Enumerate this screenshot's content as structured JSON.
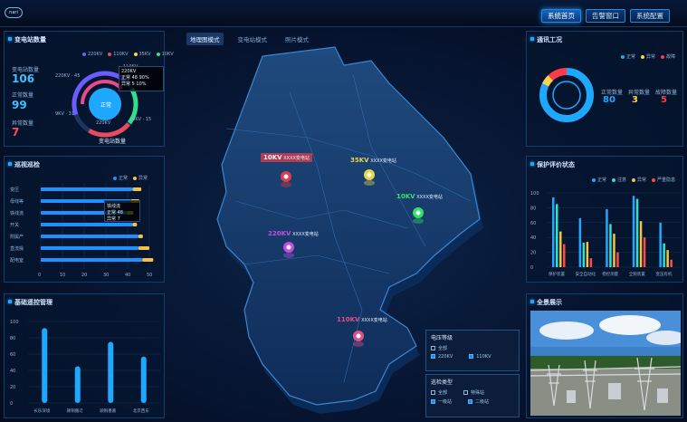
{
  "header": {
    "logo": "nari",
    "buttons": [
      "系统首页",
      "告警窗口",
      "系统配置"
    ],
    "active": 0
  },
  "panel1": {
    "title": "变电站数量",
    "legend": [
      {
        "label": "220KV",
        "color": "#6a5cff"
      },
      {
        "label": "110KV",
        "color": "#e84a5f"
      },
      {
        "label": "35KV",
        "color": "#ffd34e"
      },
      {
        "label": "10KV",
        "color": "#2ee08a"
      }
    ],
    "stats": [
      {
        "label": "变电站数量",
        "value": "106"
      },
      {
        "label": "正常数量",
        "value": "99"
      },
      {
        "label": "异常数量",
        "value": "7"
      }
    ],
    "ring_labels": [
      "220KV · 45",
      "110KV",
      "9KV · 31",
      "220KV",
      "10KV · 15"
    ],
    "tooltip": {
      "title": "220KV",
      "rows": [
        {
          "k": "正常",
          "v": "48",
          "p": "90%"
        },
        {
          "k": "异常",
          "v": "5",
          "p": "10%"
        }
      ]
    },
    "center": "正常",
    "caption": "变电站数量"
  },
  "panel2": {
    "title": "巡视巡检",
    "legend": [
      {
        "label": "正常",
        "color": "#1e90ff"
      },
      {
        "label": "异常",
        "color": "#f5c242"
      }
    ],
    "categories": [
      "变压",
      "母线等",
      "铁线流",
      "开关",
      "附属产",
      "直流操",
      "配电室"
    ],
    "normal": [
      47,
      46,
      44,
      47,
      50,
      50,
      52
    ],
    "abnormal": [
      4,
      4,
      3,
      2,
      2,
      5,
      5
    ],
    "xticks": [
      "0",
      "10",
      "20",
      "30",
      "40",
      "50"
    ],
    "tooltip": {
      "title": "铁线流",
      "rows": [
        {
          "k": "正常",
          "v": "48"
        },
        {
          "k": "异常",
          "v": "7"
        }
      ]
    }
  },
  "panel3": {
    "title": "基础遥控管理",
    "yticks": [
      "100",
      "80",
      "60",
      "40",
      "20",
      "0"
    ],
    "categories": [
      "长乐深境",
      "颍铜搬迁",
      "颍铜墨葛",
      "北京西东"
    ],
    "values": [
      92,
      45,
      75,
      57
    ]
  },
  "map": {
    "tabs": [
      "地理图模式",
      "变电站模式",
      "照片模式"
    ],
    "active_tab": 0,
    "markers": [
      {
        "level": "10KV",
        "name": "XXXX变电站",
        "color": "#e23b4c"
      },
      {
        "level": "35KV",
        "name": "XXXX变电站",
        "color": "#e8d64a"
      },
      {
        "level": "10KV",
        "name": "XXXX变电站",
        "color": "#34e06a"
      },
      {
        "level": "220KV",
        "name": "XXXX变电站",
        "color": "#c24fe0"
      },
      {
        "level": "110KV",
        "name": "XXXX变电站",
        "color": "#e0508a"
      }
    ],
    "filter1": {
      "title": "电压等级",
      "options": [
        {
          "label": "全部",
          "on": false
        },
        {
          "label": "220KV",
          "on": true
        },
        {
          "label": "110KV",
          "on": true
        }
      ]
    },
    "filter2": {
      "title": "巡检类型",
      "options": [
        {
          "label": "全部",
          "on": false
        },
        {
          "label": "特殊站",
          "on": false
        },
        {
          "label": "一级站",
          "on": true
        },
        {
          "label": "二级站",
          "on": true
        }
      ]
    }
  },
  "panel4": {
    "title": "通讯工况",
    "legend": [
      {
        "label": "正常",
        "color": "#1ea8ff"
      },
      {
        "label": "异常",
        "color": "#ffd34e"
      },
      {
        "label": "故障",
        "color": "#ff3b4a"
      }
    ],
    "stats": [
      {
        "label": "正常数量",
        "value": "80",
        "color": "#1ea8ff"
      },
      {
        "label": "异常数量",
        "value": "3",
        "color": "#ffd34e"
      },
      {
        "label": "故障数量",
        "value": "5",
        "color": "#ff3b4a"
      }
    ],
    "fractions": [
      0.82,
      0.06,
      0.12
    ]
  },
  "panel5": {
    "title": "保护评价状态",
    "legend": [
      {
        "label": "正常",
        "color": "#1ea8ff"
      },
      {
        "label": "注意",
        "color": "#2ee0d0"
      },
      {
        "label": "异常",
        "color": "#f5c242"
      },
      {
        "label": "严重隐患",
        "color": "#ff4a4a"
      }
    ],
    "yticks": [
      "100",
      "80",
      "60",
      "40",
      "20",
      "0"
    ],
    "categories": [
      "保护装置",
      "安全自动化",
      "稳控测量",
      "全频装置",
      "变压有机"
    ],
    "series": [
      [
        94,
        66,
        78,
        96,
        60
      ],
      [
        85,
        33,
        58,
        92,
        32
      ],
      [
        48,
        34,
        45,
        62,
        23
      ],
      [
        31,
        12,
        20,
        40,
        10
      ]
    ]
  },
  "panel6": {
    "title": "全景展示"
  }
}
